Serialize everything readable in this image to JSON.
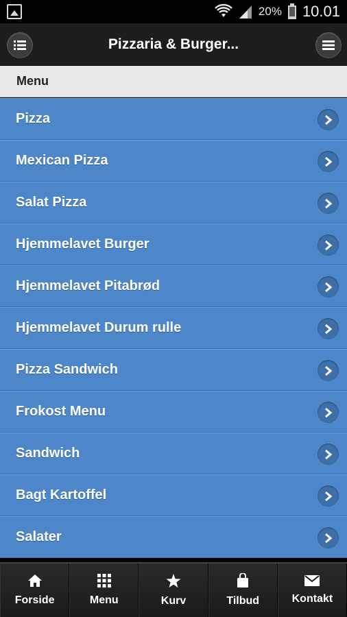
{
  "status_bar": {
    "battery": "20%",
    "time": "10.01"
  },
  "header": {
    "title": "Pizzaria & Burger..."
  },
  "section": {
    "label": "Menu"
  },
  "menu_items": [
    {
      "label": "Pizza"
    },
    {
      "label": "Mexican Pizza"
    },
    {
      "label": "Salat Pizza"
    },
    {
      "label": "Hjemmelavet Burger"
    },
    {
      "label": "Hjemmelavet Pitabrød"
    },
    {
      "label": "Hjemmelavet Durum rulle"
    },
    {
      "label": "Pizza Sandwich"
    },
    {
      "label": "Frokost Menu"
    },
    {
      "label": "Sandwich"
    },
    {
      "label": "Bagt Kartoffel"
    },
    {
      "label": "Salater"
    }
  ],
  "bottom_nav": [
    {
      "label": "Forside",
      "icon": "home-icon"
    },
    {
      "label": "Menu",
      "icon": "grid-icon"
    },
    {
      "label": "Kurv",
      "icon": "star-icon"
    },
    {
      "label": "Tilbud",
      "icon": "bag-icon"
    },
    {
      "label": "Kontakt",
      "icon": "mail-icon"
    }
  ],
  "colors": {
    "list_bg": "#4d87c9",
    "header_bg": "#1d1d1d",
    "divider_bg": "#e9e9e9"
  }
}
